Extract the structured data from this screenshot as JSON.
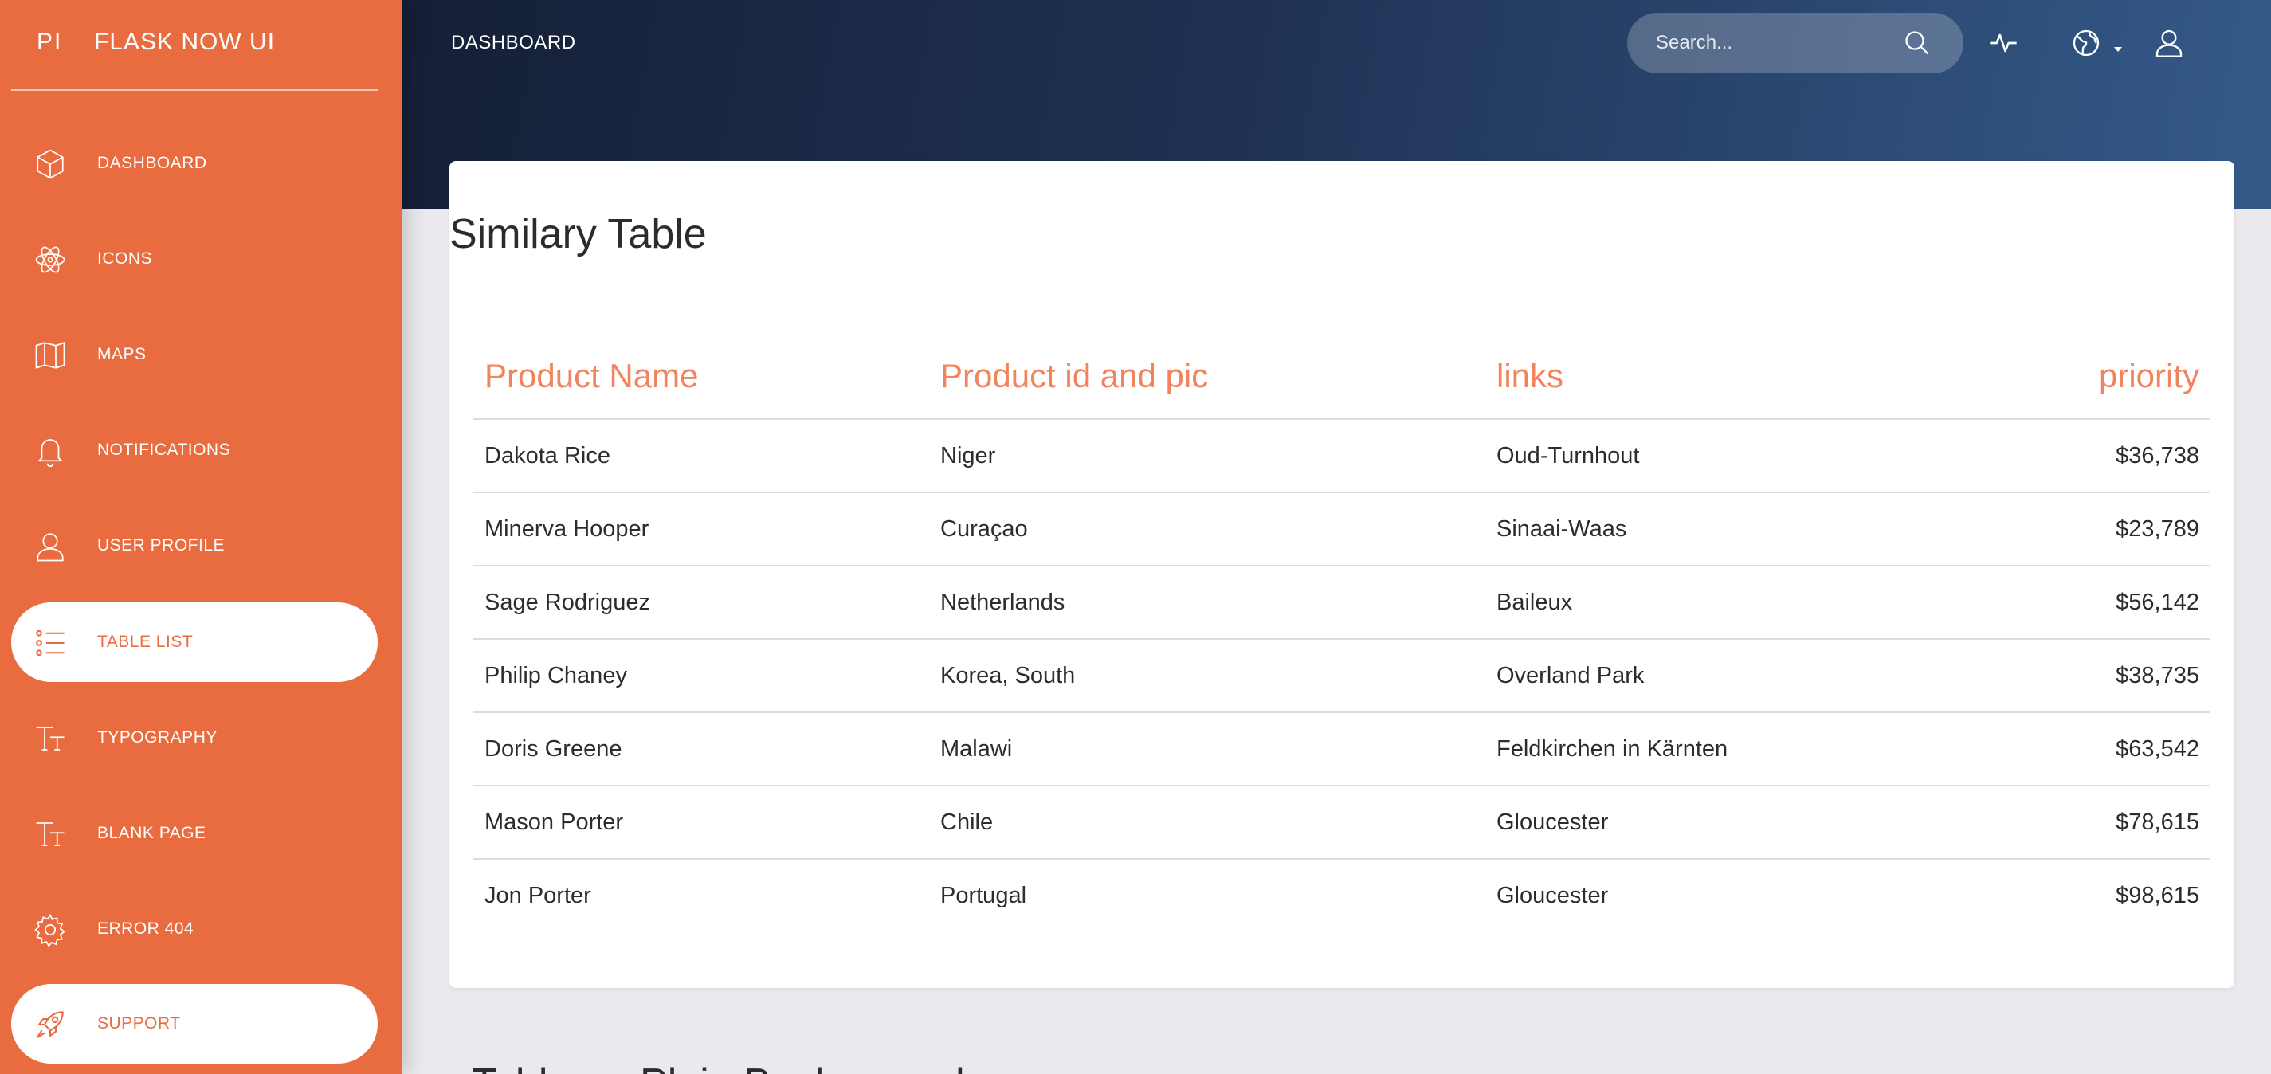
{
  "brand": {
    "mini": "PI",
    "name": "FLASK NOW UI"
  },
  "colors": {
    "accent": "#e96c40",
    "header_dark": "#151f36",
    "header_light": "#355a8a",
    "table_header": "#f0845c"
  },
  "sidebar": {
    "items": [
      {
        "label": "DASHBOARD",
        "icon": "cube-icon",
        "active": false
      },
      {
        "label": "ICONS",
        "icon": "atom-icon",
        "active": false
      },
      {
        "label": "MAPS",
        "icon": "map-icon",
        "active": false
      },
      {
        "label": "NOTIFICATIONS",
        "icon": "bell-icon",
        "active": false
      },
      {
        "label": "USER PROFILE",
        "icon": "user-icon",
        "active": false
      },
      {
        "label": "TABLE LIST",
        "icon": "list-icon",
        "active": true
      },
      {
        "label": "TYPOGRAPHY",
        "icon": "text-icon",
        "active": false
      },
      {
        "label": "BLANK PAGE",
        "icon": "text-icon",
        "active": false
      },
      {
        "label": "ERROR 404",
        "icon": "gear-icon",
        "active": false
      },
      {
        "label": "SUPPORT",
        "icon": "rocket-icon",
        "active": true
      }
    ]
  },
  "header": {
    "title": "DASHBOARD",
    "search_placeholder": "Search...",
    "icons": [
      "search-icon",
      "activity-icon",
      "globe-icon",
      "user-icon"
    ]
  },
  "card": {
    "title": "Similary Table",
    "columns": [
      "Product Name",
      "Product id and pic",
      "links",
      "priority"
    ],
    "rows": [
      [
        "Dakota Rice",
        "Niger",
        "Oud-Turnhout",
        "$36,738"
      ],
      [
        "Minerva Hooper",
        "Curaçao",
        "Sinaai-Waas",
        "$23,789"
      ],
      [
        "Sage Rodriguez",
        "Netherlands",
        "Baileux",
        "$56,142"
      ],
      [
        "Philip Chaney",
        "Korea, South",
        "Overland Park",
        "$38,735"
      ],
      [
        "Doris Greene",
        "Malawi",
        "Feldkirchen in Kärnten",
        "$63,542"
      ],
      [
        "Mason Porter",
        "Chile",
        "Gloucester",
        "$78,615"
      ],
      [
        "Jon Porter",
        "Portugal",
        "Gloucester",
        "$98,615"
      ]
    ]
  },
  "next_section": {
    "title": "Table on Plain Background"
  }
}
